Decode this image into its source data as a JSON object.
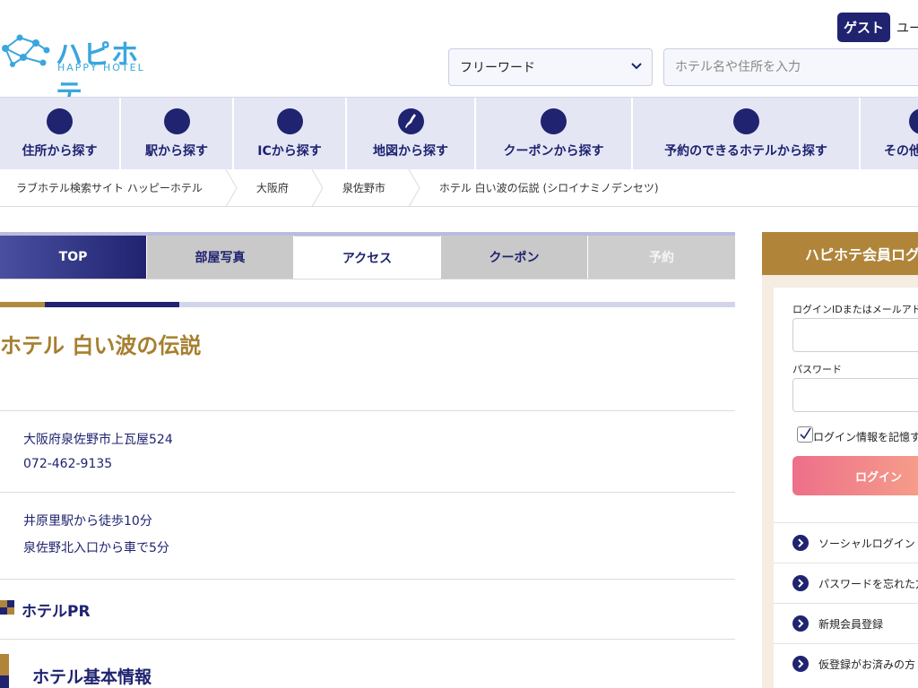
{
  "header": {
    "logo_jp": "ハピホテ",
    "logo_en": "HAPPY HOTEL",
    "guest_label": "ゲスト",
    "user_link": "ユー",
    "search_select_value": "フリーワード",
    "search_placeholder": "ホテル名や住所を入力"
  },
  "nav": {
    "items": [
      {
        "label": "住所から探す",
        "icon": "location-icon"
      },
      {
        "label": "駅から探す",
        "icon": "train-icon"
      },
      {
        "label": "ICから探す",
        "icon": "highway-icon"
      },
      {
        "label": "地図から探す",
        "icon": "japan-map-icon"
      },
      {
        "label": "クーポンから探す",
        "icon": "coupon-icon"
      },
      {
        "label": "予約のできるホテルから探す",
        "icon": "reservation-icon"
      },
      {
        "label": "その他",
        "icon": "more-icon"
      }
    ]
  },
  "breadcrumb": [
    "ラブホテル検索サイト ハッピーホテル",
    "大阪府",
    "泉佐野市",
    "ホテル 白い波の伝説 (シロイナミノデンセツ)"
  ],
  "tabs": [
    {
      "label": "TOP"
    },
    {
      "label": "部屋写真"
    },
    {
      "label": "アクセス"
    },
    {
      "label": "クーポン"
    },
    {
      "label": "予約"
    }
  ],
  "hotel": {
    "name": "ホテル 白い波の伝説",
    "address": "大阪府泉佐野市上瓦屋524",
    "phone": "072-462-9135",
    "access_1": "井原里駅から徒歩10分",
    "access_2": "泉佐野北入口から車で5分",
    "pr_title": "ホテルPR",
    "basic_info_title": "ホテル基本情報"
  },
  "login": {
    "title": "ハピホテ会員ログ",
    "id_label": "ログインIDまたはメールアドレ",
    "password_label": "パスワード",
    "remember_label": "ログイン情報を記憶す",
    "remember_checked": true,
    "login_button": "ログイン",
    "links": [
      "ソーシャルログイン",
      "パスワードを忘れた方",
      "新規会員登録",
      "仮登録がお済みの方"
    ]
  },
  "colors": {
    "navy": "#1f2370",
    "gold": "#b0853a",
    "title_gold": "#a67f2f",
    "nav_bg": "#e4e6f4",
    "logo_blue": "#3aa6de"
  }
}
